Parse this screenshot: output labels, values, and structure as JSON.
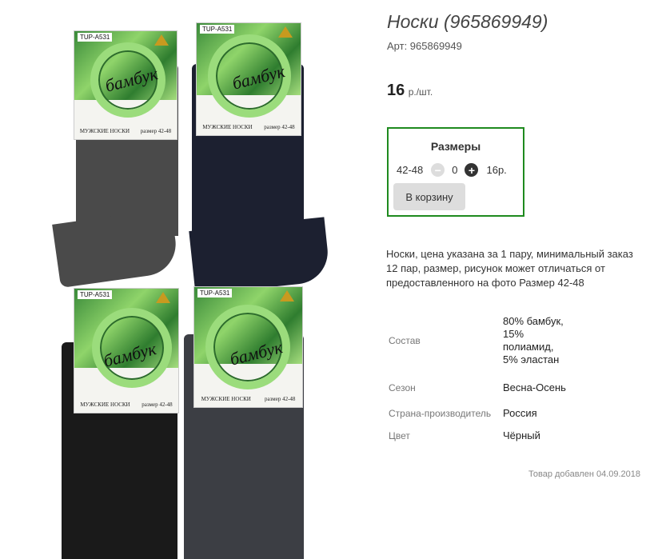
{
  "product": {
    "title": "Носки (965869949)",
    "sku_label": "Арт: 965869949",
    "price_value": "16",
    "price_unit": "р./шт."
  },
  "sizes": {
    "title": "Размеры",
    "size_label": "42-48",
    "minus_icon": "−",
    "plus_icon": "+",
    "quantity": "0",
    "row_price": "16р.",
    "cart_button": "В корзину"
  },
  "description": "Носки, цена указана за 1 пару, минимальный заказ 12 пар, размер, рисунок может отличаться от предоставленного на фото Размер 42-48",
  "properties": [
    {
      "key": "Состав",
      "value": "80% бамбук, 15% полиамид, 5% эластан"
    },
    {
      "key": "Сезон",
      "value": "Весна-Осень"
    },
    {
      "key": "Страна-производитель",
      "value": "Россия"
    },
    {
      "key": "Цвет",
      "value": "Чёрный"
    }
  ],
  "added_text": "Товар добавлен 04.09.2018",
  "image": {
    "brand": "бамбук",
    "sku_tag": "TUP-A531",
    "caption_left": "МУЖСКИЕ НОСКИ",
    "caption_right": "размер 42-48",
    "sock_colors": [
      "#4a4a4a",
      "#1c2030",
      "#1a1a1a",
      "#3c3e44"
    ]
  },
  "colors": {
    "accent_border": "#1e8a1e",
    "button_bg": "#dddddd"
  }
}
